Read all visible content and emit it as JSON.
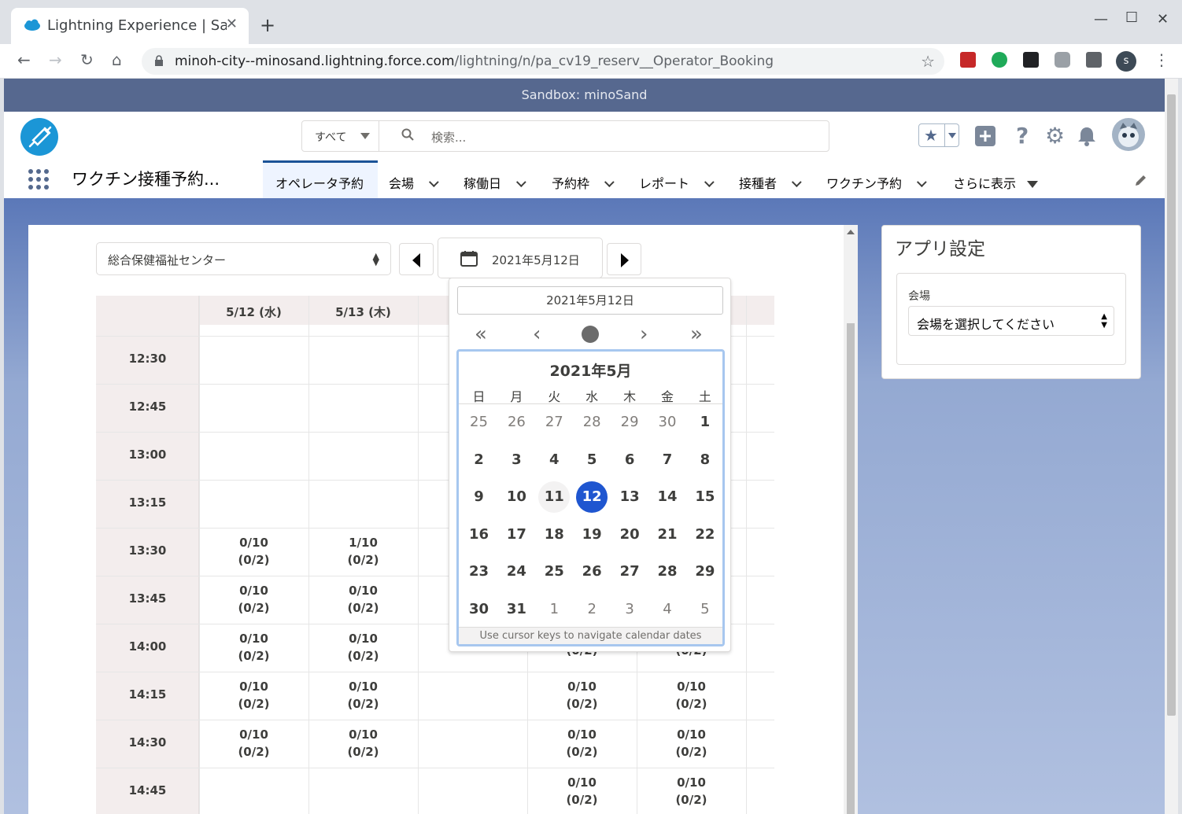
{
  "browser": {
    "tab_title": "Lightning Experience | Salesforce",
    "url_host": "minoh-city--minosand.lightning.force.com",
    "url_path": "/lightning/n/pa_cv19_reserv__Operator_Booking",
    "profile_initial": "s"
  },
  "sandbox_banner": "Sandbox: minoSand",
  "header": {
    "search_scope": "すべて",
    "search_placeholder": "検索..."
  },
  "app": {
    "name": "ワクチン接種予約...",
    "nav": [
      {
        "label": "オペレータ予約",
        "active": true
      },
      {
        "label": "会場"
      },
      {
        "label": "稼働日"
      },
      {
        "label": "予約枠"
      },
      {
        "label": "レポート"
      },
      {
        "label": "接種者"
      },
      {
        "label": "ワクチン予約"
      },
      {
        "label": "さらに表示"
      }
    ]
  },
  "booking": {
    "venue": "総合保健福祉センター",
    "date_button": "2021年5月12日",
    "day_headers": [
      "5/12 (水)",
      "5/13 (木)",
      "",
      "",
      "",
      ""
    ],
    "time_slots": [
      "12:30",
      "12:45",
      "13:00",
      "13:15",
      "13:30",
      "13:45",
      "14:00",
      "14:15",
      "14:30",
      "14:45"
    ],
    "cells": {
      "c0": [
        "",
        "",
        "",
        "",
        "0/10\n(0/2)",
        "0/10\n(0/2)",
        "0/10\n(0/2)",
        "0/10\n(0/2)",
        "0/10\n(0/2)",
        ""
      ],
      "c1": [
        "",
        "",
        "",
        "",
        "1/10\n(0/2)",
        "0/10\n(0/2)",
        "0/10\n(0/2)",
        "0/10\n(0/2)",
        "0/10\n(0/2)",
        ""
      ],
      "c3": [
        "",
        "",
        "",
        "",
        "",
        "",
        "(0/2)",
        "0/10\n(0/2)",
        "0/10\n(0/2)",
        "0/10\n(0/2)"
      ],
      "c4": [
        "",
        "",
        "",
        "",
        "",
        "",
        "(0/2)",
        "0/10\n(0/2)",
        "0/10\n(0/2)",
        "0/10\n(0/2)"
      ]
    }
  },
  "datepicker": {
    "input_value": "2021年5月12日",
    "month_label": "2021年5月",
    "weekdays": [
      "日",
      "月",
      "火",
      "水",
      "木",
      "金",
      "土"
    ],
    "weeks": [
      [
        "25",
        "26",
        "27",
        "28",
        "29",
        "30",
        "1"
      ],
      [
        "2",
        "3",
        "4",
        "5",
        "6",
        "7",
        "8"
      ],
      [
        "9",
        "10",
        "11",
        "12",
        "13",
        "14",
        "15"
      ],
      [
        "16",
        "17",
        "18",
        "19",
        "20",
        "21",
        "22"
      ],
      [
        "23",
        "24",
        "25",
        "26",
        "27",
        "28",
        "29"
      ],
      [
        "30",
        "31",
        "1",
        "2",
        "3",
        "4",
        "5"
      ]
    ],
    "selected": "12",
    "hint": "Use cursor keys to navigate calendar dates"
  },
  "settings": {
    "title": "アプリ設定",
    "venue_label": "会場",
    "venue_placeholder": "会場を選択してください"
  }
}
